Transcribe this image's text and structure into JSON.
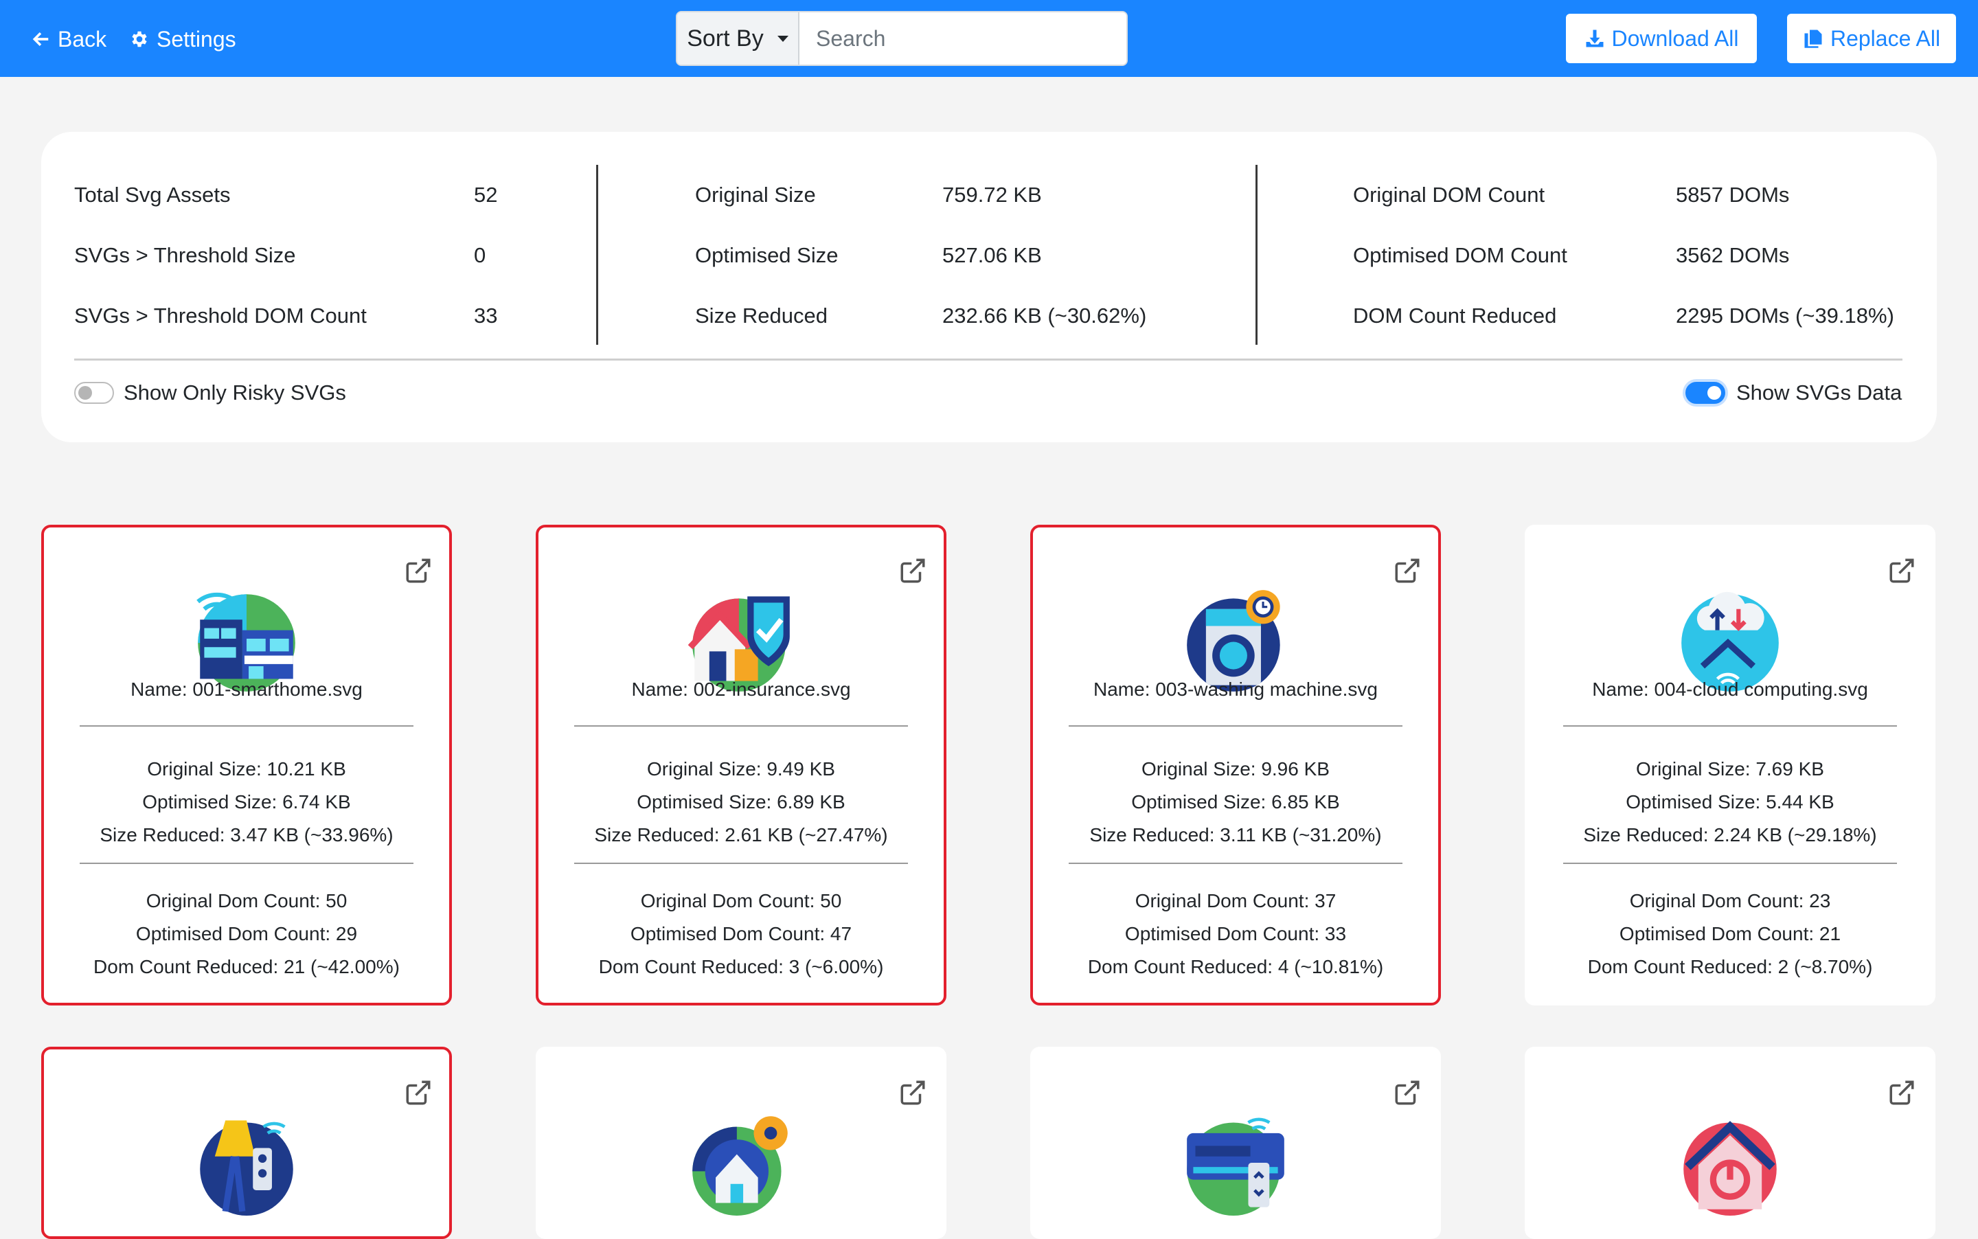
{
  "nav": {
    "back_label": "Back",
    "settings_label": "Settings"
  },
  "search": {
    "sort_label": "Sort By",
    "placeholder": "Search"
  },
  "actions": {
    "download_all_label": "Download All",
    "replace_all_label": "Replace All"
  },
  "summary": {
    "total_assets_label": "Total Svg Assets",
    "total_assets_value": "52",
    "threshold_size_label": "SVGs > Threshold Size",
    "threshold_size_value": "0",
    "threshold_dom_label": "SVGs > Threshold DOM Count",
    "threshold_dom_value": "33",
    "original_size_label": "Original Size",
    "original_size_value": "759.72 KB",
    "optimised_size_label": "Optimised Size",
    "optimised_size_value": "527.06 KB",
    "size_reduced_label": "Size Reduced",
    "size_reduced_value": "232.66 KB (~30.62%)",
    "original_dom_label": "Original DOM Count",
    "original_dom_value": "5857 DOMs",
    "optimised_dom_label": "Optimised DOM Count",
    "optimised_dom_value": "3562 DOMs",
    "dom_reduced_label": "DOM Count Reduced",
    "dom_reduced_value": "2295 DOMs (~39.18%)",
    "risky_toggle_label": "Show Only Risky SVGs",
    "risky_toggle_on": false,
    "data_toggle_label": "Show SVGs Data",
    "data_toggle_on": true
  },
  "colors": {
    "primary": "#1a85ff",
    "risky_border": "#e3202d",
    "background": "#f4f4f4"
  },
  "cards": [
    {
      "icon": "smarthome-icon",
      "risky": true,
      "name": "Name: 001-smarthome.svg",
      "original_size": "Original Size: 10.21 KB",
      "optimised_size": "Optimised Size: 6.74 KB",
      "size_reduced": "Size Reduced: 3.47 KB (~33.96%)",
      "original_dom": "Original Dom Count: 50",
      "optimised_dom": "Optimised Dom Count: 29",
      "dom_reduced": "Dom Count Reduced: 21 (~42.00%)"
    },
    {
      "icon": "insurance-icon",
      "risky": true,
      "name": "Name: 002-insurance.svg",
      "original_size": "Original Size: 9.49 KB",
      "optimised_size": "Optimised Size: 6.89 KB",
      "size_reduced": "Size Reduced: 2.61 KB (~27.47%)",
      "original_dom": "Original Dom Count: 50",
      "optimised_dom": "Optimised Dom Count: 47",
      "dom_reduced": "Dom Count Reduced: 3 (~6.00%)"
    },
    {
      "icon": "washing-machine-icon",
      "risky": true,
      "name": "Name: 003-washing machine.svg",
      "original_size": "Original Size: 9.96 KB",
      "optimised_size": "Optimised Size: 6.85 KB",
      "size_reduced": "Size Reduced: 3.11 KB (~31.20%)",
      "original_dom": "Original Dom Count: 37",
      "optimised_dom": "Optimised Dom Count: 33",
      "dom_reduced": "Dom Count Reduced: 4 (~10.81%)"
    },
    {
      "icon": "cloud-computing-icon",
      "risky": false,
      "name": "Name: 004-cloud computing.svg",
      "original_size": "Original Size: 7.69 KB",
      "optimised_size": "Optimised Size: 5.44 KB",
      "size_reduced": "Size Reduced: 2.24 KB (~29.18%)",
      "original_dom": "Original Dom Count: 23",
      "optimised_dom": "Optimised Dom Count: 21",
      "dom_reduced": "Dom Count Reduced: 2 (~8.70%)"
    },
    {
      "icon": "smart-lamp-icon",
      "risky": true
    },
    {
      "icon": "home-settings-icon",
      "risky": false
    },
    {
      "icon": "air-conditioner-icon",
      "risky": false
    },
    {
      "icon": "home-power-icon",
      "risky": false
    }
  ]
}
